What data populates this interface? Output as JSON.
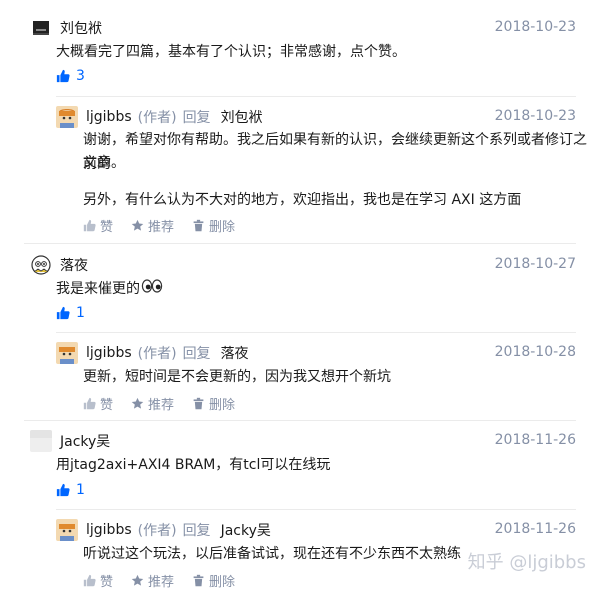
{
  "comments": [
    {
      "user": "刘包袱",
      "date": "2018-10-23",
      "text": "大概看完了四篇，基本有了个认识；非常感谢，点个赞。",
      "likes": "3",
      "reply": {
        "user": "ljgibbs",
        "author_tag": "(作者)",
        "reply_word": "回复",
        "target": "刘包袱",
        "date": "2018-10-23",
        "line1": "谢谢，希望对你有帮助。我之后如果有新的认识，会继续更新这个系列或者修订之前的",
        "line2": "文章。",
        "line3": "另外，有什么认为不大对的地方，欢迎指出，我也是在学习 AXI 这方面"
      }
    },
    {
      "user": "落夜",
      "date": "2018-10-27",
      "text": "我是来催更的",
      "likes": "1",
      "reply": {
        "user": "ljgibbs",
        "author_tag": "(作者)",
        "reply_word": "回复",
        "target": "落夜",
        "date": "2018-10-28",
        "line1": "更新，短时间是不会更新的，因为我又想开个新坑"
      }
    },
    {
      "user": "Jacky吴",
      "date": "2018-11-26",
      "text": "用jtag2axi+AXI4 BRAM，有tcl可以在线玩",
      "likes": "1",
      "reply": {
        "user": "ljgibbs",
        "author_tag": "(作者)",
        "reply_word": "回复",
        "target": "Jacky吴",
        "date": "2018-11-26",
        "line1": "听说过这个玩法，以后准备试试，现在还有不少东西不太熟练"
      }
    }
  ],
  "actions": {
    "like": "赞",
    "recommend": "推荐",
    "delete": "删除"
  },
  "watermark": "知乎 @ljgibbs",
  "colors": {
    "accent": "#0066ff",
    "meta": "#8590a6",
    "divider": "#ebebeb"
  },
  "icons": [
    "thumb-up-icon",
    "star-icon",
    "trash-icon"
  ]
}
